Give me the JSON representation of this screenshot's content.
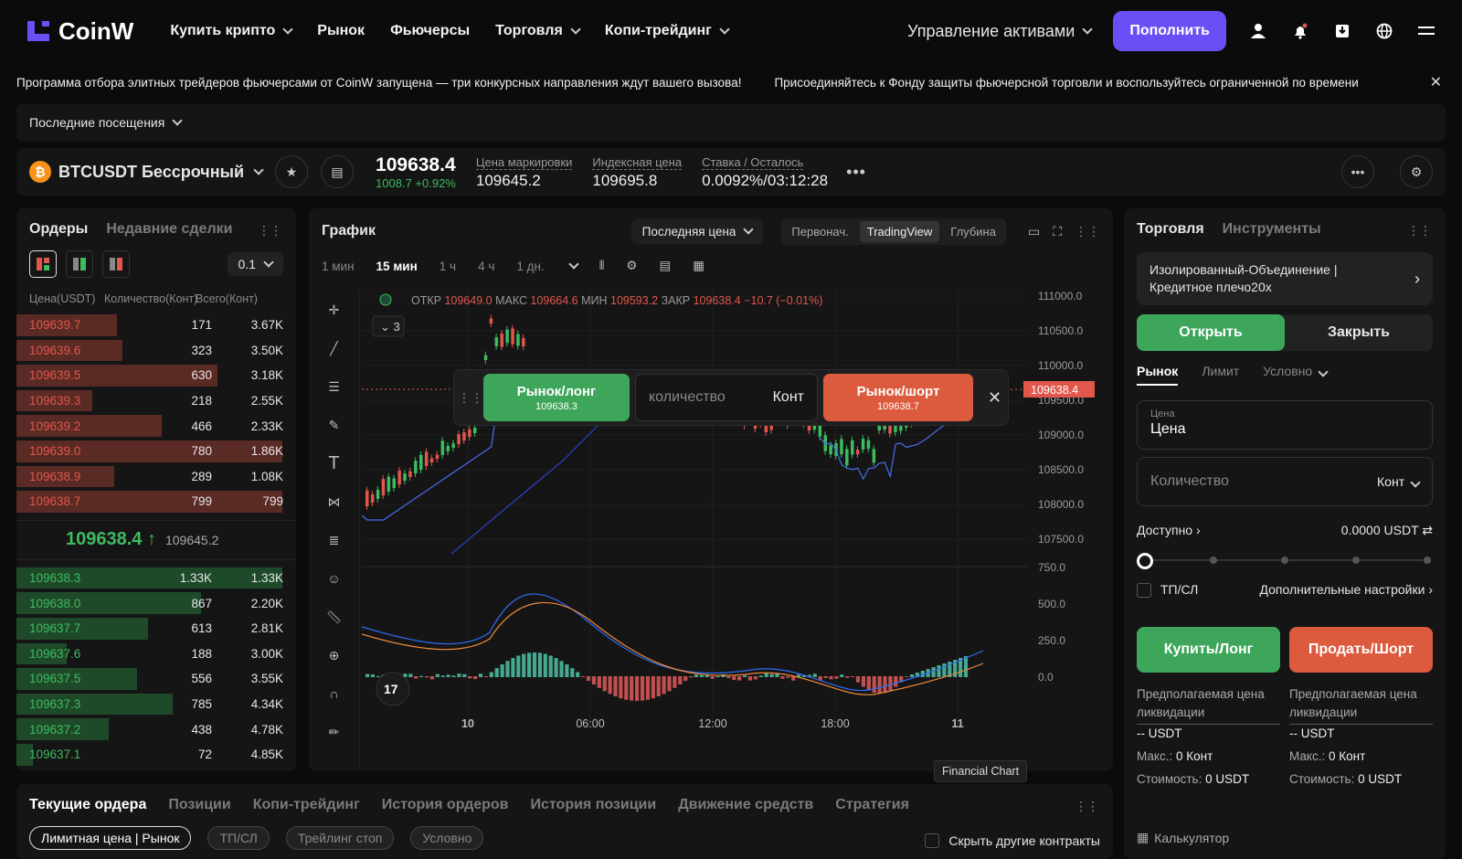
{
  "nav": {
    "brand": "CoinW",
    "items": [
      {
        "label": "Купить крипто",
        "dropdown": true
      },
      {
        "label": "Рынок",
        "dropdown": false
      },
      {
        "label": "Фьючерсы",
        "dropdown": false
      },
      {
        "label": "Торговля",
        "dropdown": true
      },
      {
        "label": "Копи-трейдинг",
        "dropdown": true
      }
    ],
    "asset_mgmt": "Управление активами",
    "deposit": "Пополнить",
    "icons": [
      "user-icon",
      "bell-icon",
      "download-icon",
      "globe-icon",
      "menu-icon"
    ]
  },
  "ticker": {
    "msg1": "Программа отбора элитных трейдеров фьючерсами от CoinW запущена — три конкурсных направления ждут вашего вызова!",
    "msg2": "Присоединяйтесь к Фонду защиты фьючерсной торговли и воспользуйтесь ограниченной по времени"
  },
  "recent": {
    "label": "Последние посещения"
  },
  "symbol": {
    "name": "BTCUSDT Бессрочный",
    "last": "109638.4",
    "change": "1008.7 +0.92%",
    "mark_label": "Цена маркировки",
    "mark": "109645.2",
    "index_label": "Индексная цена",
    "index": "109695.8",
    "rate_label": "Ставка / Осталось",
    "rate": "0.0092%/03:12:28"
  },
  "orderbook": {
    "tab_orders": "Ордеры",
    "tab_trades": "Недавние сделки",
    "tick": "0.1",
    "col_price": "Цена(USDT)",
    "col_qty": "Количество(Конт)",
    "col_total": "Всего(Конт)",
    "asks": [
      {
        "p": "109639.7",
        "q": "171",
        "t": "3.67K",
        "depth": 0.36
      },
      {
        "p": "109639.6",
        "q": "323",
        "t": "3.50K",
        "depth": 0.38
      },
      {
        "p": "109639.5",
        "q": "630",
        "t": "3.18K",
        "depth": 0.72
      },
      {
        "p": "109639.3",
        "q": "218",
        "t": "2.55K",
        "depth": 0.27
      },
      {
        "p": "109639.2",
        "q": "466",
        "t": "2.33K",
        "depth": 0.52
      },
      {
        "p": "109639.0",
        "q": "780",
        "t": "1.86K",
        "depth": 0.95
      },
      {
        "p": "109638.9",
        "q": "289",
        "t": "1.08K",
        "depth": 0.35
      },
      {
        "p": "109638.7",
        "q": "799",
        "t": "799",
        "depth": 0.95
      }
    ],
    "last": "109638.4",
    "mark": "109645.2",
    "bids": [
      {
        "p": "109638.3",
        "q": "1.33K",
        "t": "1.33K",
        "depth": 0.95
      },
      {
        "p": "109638.0",
        "q": "867",
        "t": "2.20K",
        "depth": 0.66
      },
      {
        "p": "109637.7",
        "q": "613",
        "t": "2.81K",
        "depth": 0.47
      },
      {
        "p": "109637.6",
        "q": "188",
        "t": "3.00K",
        "depth": 0.18
      },
      {
        "p": "109637.5",
        "q": "556",
        "t": "3.55K",
        "depth": 0.43
      },
      {
        "p": "109637.3",
        "q": "785",
        "t": "4.34K",
        "depth": 0.56
      },
      {
        "p": "109637.2",
        "q": "438",
        "t": "4.78K",
        "depth": 0.33
      },
      {
        "p": "109637.1",
        "q": "72",
        "t": "4.85K",
        "depth": 0.06
      }
    ]
  },
  "chart": {
    "title": "График",
    "price_source": "Последняя цена",
    "views": [
      "Первонач.",
      "TradingView",
      "Глубина"
    ],
    "timeframes": [
      "1 мин",
      "15 мин",
      "1 ч",
      "4 ч",
      "1 дн."
    ],
    "selected_tf": "15 мин",
    "ohlc": {
      "o_label": "ОТКР",
      "o": "109649.0",
      "h_label": "МАКС",
      "h": "109664.6",
      "l_label": "МИН",
      "l": "109593.2",
      "c_label": "ЗАКР",
      "c": "109638.4",
      "chg": "−10.7 (−0.01%)"
    },
    "indicator_count": "3",
    "price_axis": [
      "111000.0",
      "110500.0",
      "110000.0",
      "109500.0",
      "109000.0",
      "108500.0",
      "108000.0",
      "107500.0"
    ],
    "macd_axis": [
      "750.0",
      "500.0",
      "250.0",
      "0.0"
    ],
    "time_axis": [
      "10",
      "06:00",
      "12:00",
      "18:00",
      "11"
    ],
    "last_tag": "109638.4",
    "tooltip": "Financial Chart"
  },
  "quick_trade": {
    "long": "Рынок/лонг",
    "long_price": "109638.3",
    "qty_placeholder": "количество",
    "unit": "Конт",
    "short": "Рынок/шорт",
    "short_price": "109638.7"
  },
  "trade": {
    "tab_trade": "Торговля",
    "tab_tools": "Инструменты",
    "margin": "Изолированный-Объединение | Кредитное плечо20x",
    "open": "Открыть",
    "close": "Закрыть",
    "types": [
      "Рынок",
      "Лимит",
      "Условно"
    ],
    "price_label": "Цена",
    "price_value": "Цена",
    "qty_placeholder": "Количество",
    "qty_unit": "Конт",
    "avail_label": "Доступно",
    "avail_value": "0.0000 USDT",
    "tpsl": "ТП/СЛ",
    "more": "Дополнительные настройки",
    "buy": "Купить/Лонг",
    "sell": "Продать/Шорт",
    "liq_label": "Предполагаемая цена ликвидации",
    "liq_val": "-- USDT",
    "max_label": "Макс.:",
    "max_val": "0 Конт",
    "cost_label": "Стоимость:",
    "cost_val": "0 USDT",
    "calc": "Калькулятор"
  },
  "bottom": {
    "tabs": [
      "Текущие ордера",
      "Позиции",
      "Копи-трейдинг",
      "История ордеров",
      "История позиции",
      "Движение средств",
      "Стратегия"
    ],
    "filters": [
      "Лимитная цена | Рынок",
      "ТП/СЛ",
      "Трейлинг стоп",
      "Условно"
    ],
    "hide_others": "Скрыть другие контракты"
  },
  "colors": {
    "up": "#3dbb5f",
    "down": "#e2574c",
    "accent": "#6b4ef5"
  }
}
